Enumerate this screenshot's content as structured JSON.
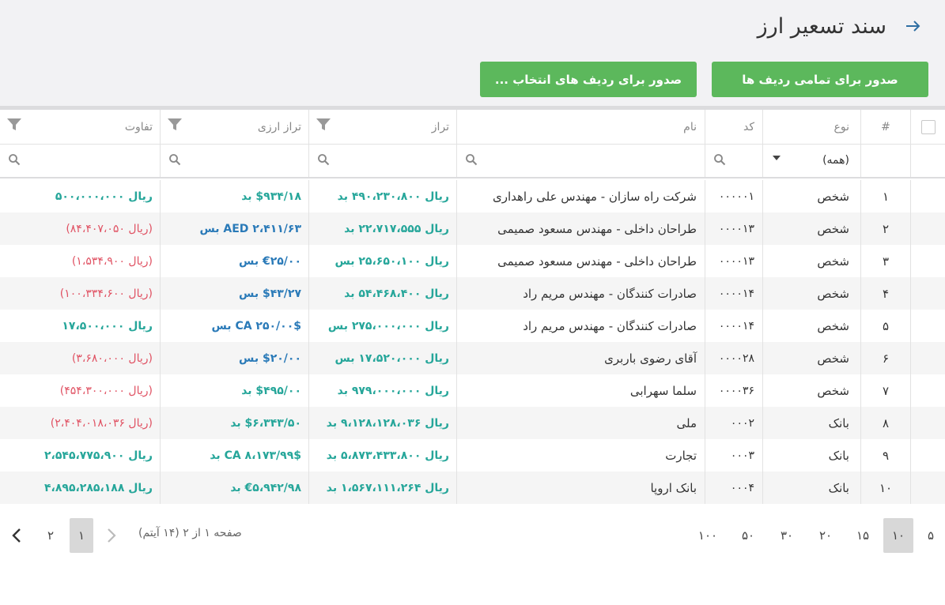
{
  "header": {
    "title": "سند تسعیر ارز",
    "btn_all": "صدور برای تمامی ردیف ها",
    "btn_selected": "صدور برای ردیف های انتخاب ..."
  },
  "columns": {
    "num": "#",
    "type": "نوع",
    "code": "کد",
    "name": "نام",
    "balance": "تراز",
    "fx_balance": "تراز ارزی",
    "difference": "تفاوت"
  },
  "filters": {
    "type_value": "(همه)"
  },
  "rows": [
    {
      "num": "۱",
      "type": "شخص",
      "code": "۰۰۰۰۰۱",
      "name": "شرکت راه سازان - مهندس علی راهداری",
      "balance": "ریال ۴۹۰،۲۳۰،۸۰۰ بد",
      "fx": "$۹۳۴/۱۸ بد",
      "diff": "ریال ۵۰۰،۰۰۰،۰۰۰",
      "fx_color": "green",
      "diff_color": "green"
    },
    {
      "num": "۲",
      "type": "شخص",
      "code": "۰۰۰۰۱۳",
      "name": "طراحان داخلی - مهندس مسعود صمیمی",
      "balance": "ریال ۲۲،۷۱۷،۵۵۵ بد",
      "fx": "AED ۲،۴۱۱/۶۳ بس",
      "diff": "(ریال ۸۴،۴۰۷،۰۵۰)",
      "fx_color": "blue",
      "diff_color": "red"
    },
    {
      "num": "۳",
      "type": "شخص",
      "code": "۰۰۰۰۱۳",
      "name": "طراحان داخلی - مهندس مسعود صمیمی",
      "balance": "ریال ۲۵،۶۵۰،۱۰۰ بس",
      "fx": "€۲۵/۰۰ بس",
      "diff": "(ریال ۱،۵۳۴،۹۰۰)",
      "fx_color": "blue",
      "diff_color": "red"
    },
    {
      "num": "۴",
      "type": "شخص",
      "code": "۰۰۰۰۱۴",
      "name": "صادرات کنندگان - مهندس مریم راد",
      "balance": "ریال ۵۴،۴۶۸،۴۰۰ بد",
      "fx": "$۴۳/۲۷ بس",
      "diff": "(ریال ۱۰۰،۳۳۴،۶۰۰)",
      "fx_color": "blue",
      "diff_color": "red"
    },
    {
      "num": "۵",
      "type": "شخص",
      "code": "۰۰۰۰۱۴",
      "name": "صادرات کنندگان - مهندس مریم راد",
      "balance": "ریال ۲۷۵،۰۰۰،۰۰۰ بس",
      "fx": "CA ۲۵۰/۰۰$ بس",
      "diff": "ریال ۱۷،۵۰۰،۰۰۰",
      "fx_color": "blue",
      "diff_color": "green"
    },
    {
      "num": "۶",
      "type": "شخص",
      "code": "۰۰۰۰۲۸",
      "name": "آقای رضوی باربری",
      "balance": "ریال ۱۷،۵۲۰،۰۰۰ بس",
      "fx": "$۲۰/۰۰ بس",
      "diff": "(ریال ۳،۶۸۰،۰۰۰)",
      "fx_color": "blue",
      "diff_color": "red"
    },
    {
      "num": "۷",
      "type": "شخص",
      "code": "۰۰۰۰۳۶",
      "name": "سلما سهرابی",
      "balance": "ریال ۹۷۹،۰۰۰،۰۰۰ بد",
      "fx": "$۴۹۵/۰۰ بد",
      "diff": "(ریال ۴۵۴،۳۰۰،۰۰۰)",
      "fx_color": "green",
      "diff_color": "red"
    },
    {
      "num": "۸",
      "type": "بانک",
      "code": "۰۰۰۲",
      "name": "ملی",
      "balance": "ریال ۹،۱۲۸،۱۲۸،۰۳۶ بد",
      "fx": "$۶،۳۴۳/۵۰ بد",
      "diff": "(ریال ۲،۴۰۴،۰۱۸،۰۳۶)",
      "fx_color": "green",
      "diff_color": "red"
    },
    {
      "num": "۹",
      "type": "بانک",
      "code": "۰۰۰۳",
      "name": "تجارت",
      "balance": "ریال ۵،۸۷۳،۴۳۳،۸۰۰ بد",
      "fx": "CA ۸،۱۷۳/۹۹$ بد",
      "diff": "ریال ۲،۵۴۵،۷۷۵،۹۰۰",
      "fx_color": "green",
      "diff_color": "green"
    },
    {
      "num": "۱۰",
      "type": "بانک",
      "code": "۰۰۰۴",
      "name": "بانک اروپا",
      "balance": "ریال ۱،۵۶۷،۱۱۱،۲۶۴ بد",
      "fx": "€۵،۹۴۲/۹۸ بد",
      "diff": "ریال ۴،۸۹۵،۲۸۵،۱۸۸",
      "fx_color": "green",
      "diff_color": "green"
    }
  ],
  "pager": {
    "info": "صفحه ۱ از ۲ (۱۴ آیتم)",
    "page_1": "۱",
    "page_2": "۲",
    "sizes": [
      "۵",
      "۱۰",
      "۱۵",
      "۲۰",
      "۳۰",
      "۵۰",
      "۱۰۰"
    ],
    "active_size": "۱۰"
  },
  "colors": {
    "green": "#26a69a",
    "blue": "#2a7ab8",
    "red": "#e05263",
    "button": "#5cb85c"
  }
}
